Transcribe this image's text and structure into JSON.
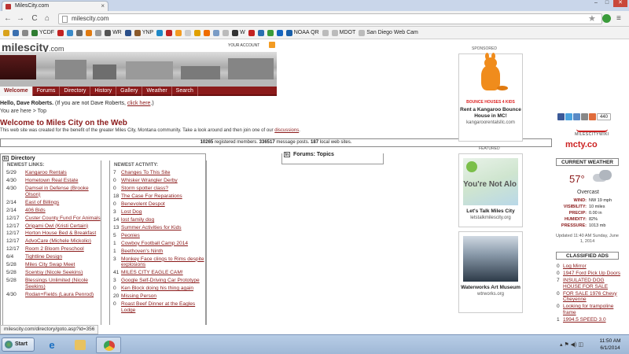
{
  "browser": {
    "tab_title": "MilesCity.com",
    "tab_close": "×",
    "url": "milescity.com",
    "window": {
      "min": "–",
      "max": "□",
      "close": "✕"
    },
    "back": "←",
    "forward": "→",
    "reload": "C",
    "home": "⌂",
    "star": "★",
    "menu": "≡",
    "bookmarks": [
      {
        "label": "",
        "color": "#d9a21c"
      },
      {
        "label": "",
        "color": "#3a6fb0"
      },
      {
        "label": "",
        "color": "#888888"
      },
      {
        "label": "YCDF",
        "color": "#2f7d32"
      },
      {
        "label": "",
        "color": "#c22222"
      },
      {
        "label": "",
        "color": "#3a8ac9"
      },
      {
        "label": "",
        "color": "#6b6b6b"
      },
      {
        "label": "",
        "color": "#e07a10"
      },
      {
        "label": "",
        "color": "#999999"
      },
      {
        "label": "WR",
        "color": "#555555"
      },
      {
        "label": "",
        "color": "#2a4f8a"
      },
      {
        "label": "YNP",
        "color": "#8b5a2b"
      },
      {
        "label": "",
        "color": "#1e88c7"
      },
      {
        "label": "",
        "color": "#c22222"
      },
      {
        "label": "",
        "color": "#f39b22"
      },
      {
        "label": "",
        "color": "#cccccc"
      },
      {
        "label": "",
        "color": "#e0a000"
      },
      {
        "label": "",
        "color": "#ef6c00"
      },
      {
        "label": "",
        "color": "#7a9cc6"
      },
      {
        "label": "",
        "color": "#bbbbbb"
      },
      {
        "label": "W",
        "color": "#333333"
      },
      {
        "label": "",
        "color": "#c22222"
      },
      {
        "label": "",
        "color": "#2a6fb0"
      },
      {
        "label": "",
        "color": "#3a9b3a"
      },
      {
        "label": "",
        "color": "#1565c0"
      },
      {
        "label": "NOAA QR",
        "color": "#1a5fa8"
      },
      {
        "label": "",
        "color": "#bbbbbb"
      },
      {
        "label": "MDOT",
        "color": "#bbbbbb"
      },
      {
        "label": "San Diego Web Cam",
        "color": "#bbbbbb"
      }
    ],
    "status_url": "milescity.com/directory/goto.asp?id=356"
  },
  "site": {
    "logo": "milescity",
    "logo_domain": ".com",
    "account": "YOUR ACCOUNT",
    "nav": [
      "Welcome",
      "Forums",
      "Directory",
      "History",
      "Gallery",
      "Weather",
      "Search"
    ],
    "hello_prefix": "Hello, Dave Roberts.",
    "hello_mid": "(If you are not Dave Roberts,",
    "hello_link": "click here",
    "hello_suffix": ".)",
    "crumb": "You are here > Top",
    "welcome_title": "Welcome to Miles City on the Web",
    "intro": "This web site was created for the benefit of the greater Miles City, Montana community. Take a look around and then join one of our",
    "intro_link": "discussions",
    "intro_end": ".",
    "stats": {
      "members": "10265",
      "members_label": "registered members.",
      "posts": "336517",
      "posts_label": "message posts.",
      "sites": "187",
      "sites_label": "local web sites."
    },
    "directory_title": "Directory",
    "box_icon": "ln",
    "forums_title": "Forums: Topics"
  },
  "newest_links": {
    "header": "NEWEST LINKS:",
    "items": [
      {
        "date": "5/29",
        "text": "Kangaroo Rentals"
      },
      {
        "date": "4/30",
        "text": "Hometown Real Estate"
      },
      {
        "date": "4/30",
        "text": "Damsel in Defense (Brooke Olson)"
      },
      {
        "date": "2/14",
        "text": "East of Billings"
      },
      {
        "date": "2/14",
        "text": "406 Bids"
      },
      {
        "date": "12/17",
        "text": "Custer County Fund For Animals"
      },
      {
        "date": "12/17",
        "text": "Origami Owl (Kristi Certain)"
      },
      {
        "date": "12/17",
        "text": "Horton House Bed & Breakfast"
      },
      {
        "date": "12/17",
        "text": "AdvoCare (Michele Mickolio)"
      },
      {
        "date": "12/17",
        "text": "Room 2 Bloom Preschool"
      },
      {
        "date": "6/4",
        "text": "Tightline Design"
      },
      {
        "date": "5/28",
        "text": "Miles City Swap Meet"
      },
      {
        "date": "5/28",
        "text": "Scentsy (Nicole Seekins)"
      },
      {
        "date": "5/28",
        "text": "Blessings Unlimited (Nicole Seekins)"
      },
      {
        "date": "4/30",
        "text": "Rodan+Fields (Laura Penrod)"
      }
    ]
  },
  "newest_activity": {
    "header": "NEWEST ACTIVITY:",
    "items": [
      {
        "n": "7",
        "text": "Changes To This Site"
      },
      {
        "n": "0",
        "text": "Whisker Wrangler Derby"
      },
      {
        "n": "0",
        "text": "Storm spotter class?"
      },
      {
        "n": "18",
        "text": "The Case For Reparations"
      },
      {
        "n": "0",
        "text": "Benevolent Despot"
      },
      {
        "n": "3",
        "text": "Lost Dog"
      },
      {
        "n": "14",
        "text": "lost family dog"
      },
      {
        "n": "13",
        "text": "Summer Activities for Kids"
      },
      {
        "n": "5",
        "text": "Peonies"
      },
      {
        "n": "1",
        "text": "Cowboy Football Camp 2014"
      },
      {
        "n": "1",
        "text": "Beethoven's Ninth"
      },
      {
        "n": "3",
        "text": "Monkey Face clings to Rims despite explosions"
      },
      {
        "n": "41",
        "text": "MILES CITY EAGLE CAM!"
      },
      {
        "n": "3",
        "text": "Google Self-Driving Car Prototype"
      },
      {
        "n": "0",
        "text": "Ken Block doing his thing again"
      },
      {
        "n": "20",
        "text": "Missing Person"
      },
      {
        "n": "0",
        "text": "Roast Beef Dinner at the Eagles Lodge"
      }
    ]
  },
  "sponsored": {
    "label": "SPONSORED",
    "ad1_logo_text": "BOUNCE HOUSES 4 KIDS",
    "ad1_caption": "Rent a Kangaroo Bounce House in MC!",
    "ad1_url": "kangaroorentalsllc.com",
    "featured_label": "FEATURED",
    "ad2_thumb_text": "You're Not Alo",
    "ad2_caption": "Let's Talk Miles City",
    "ad2_url": "letstalkmilescity.org",
    "ad3_caption": "Waterworks Art Museum",
    "ad3_url": "wtrworks.org"
  },
  "sidebar": {
    "share_count": "440",
    "wiki": "MILESCITYWIKI",
    "mcty": "mcty.co",
    "weather_hdr": "CURRENT WEATHER",
    "temp": "57°",
    "condition": "Overcast",
    "details": [
      {
        "k": "WIND:",
        "v": "NW 19 mph"
      },
      {
        "k": "VISIBILITY:",
        "v": "10 miles"
      },
      {
        "k": "PRECIP:",
        "v": "0.00 in"
      },
      {
        "k": "HUMIDITY:",
        "v": "82%"
      },
      {
        "k": "PRESSURE:",
        "v": "1013 mb"
      }
    ],
    "updated": "Updated 11:40 AM Sunday, June 1, 2014",
    "classified_hdr": "CLASSIFIED ADS",
    "classified": [
      {
        "n": "0",
        "text": "Log Mirror"
      },
      {
        "n": "0",
        "text": "1947 Ford Pick Up Doors"
      },
      {
        "n": "7",
        "text": "INSULATED DOG HOUSE FOR SALE"
      },
      {
        "n": "0",
        "text": "FOR SALE 1976 Chevy Cheyenne"
      },
      {
        "n": "0",
        "text": "Looking for trampoline frame"
      },
      {
        "n": "1",
        "text": "1994.5 SPEED 3.0"
      }
    ]
  },
  "taskbar": {
    "start": "Start",
    "ie": "e",
    "tray": "▴ ⚑ ◀) ◫",
    "time": "11:50 AM",
    "date": "6/1/2014"
  }
}
